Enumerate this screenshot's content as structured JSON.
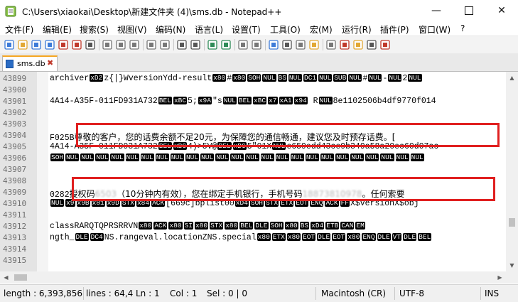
{
  "window": {
    "title": "C:\\Users\\xiaokai\\Desktop\\新建文件夹 (4)\\sms.db - Notepad++",
    "minimize": "—",
    "close": "✕"
  },
  "menu": [
    "文件(F)",
    "编辑(E)",
    "搜索(S)",
    "视图(V)",
    "编码(N)",
    "语言(L)",
    "设置(T)",
    "工具(O)",
    "宏(M)",
    "运行(R)",
    "插件(P)",
    "窗口(W)",
    "?"
  ],
  "toolbar_icons": [
    "new-file-icon",
    "open-file-icon",
    "save-icon",
    "save-all-icon",
    "close-icon",
    "close-all-icon",
    "print-icon",
    "cut-icon",
    "copy-icon",
    "paste-icon",
    "undo-icon",
    "redo-icon",
    "find-icon",
    "replace-icon",
    "zoom-in-icon",
    "zoom-out-icon",
    "sync-v-icon",
    "sync-h-icon",
    "word-wrap-icon",
    "all-chars-icon",
    "indent-guide-icon",
    "udl-icon",
    "doc-map-icon",
    "function-list-icon",
    "folder-workspace-icon",
    "monitor-icon",
    "record-macro-icon"
  ],
  "tab": {
    "label": "sms.db",
    "close": "✖"
  },
  "editor": {
    "lines": [
      {
        "no": "43899",
        "segments": [
          {
            "t": "archiver"
          },
          {
            "c": "xD2"
          },
          {
            "t": "z{|}WversionYdd-result"
          },
          {
            "c": "x80"
          },
          {
            "t": "#"
          },
          {
            "c": "x80"
          },
          {
            "c": "SOH"
          },
          {
            "c": "NUL"
          },
          {
            "c": "BS"
          },
          {
            "c": "NUL"
          },
          {
            "c": "DC1"
          },
          {
            "c": "NUL"
          },
          {
            "c": "SUB"
          },
          {
            "c": "NUL"
          },
          {
            "t": "#"
          },
          {
            "c": "NUL"
          },
          {
            "t": "-"
          },
          {
            "c": "NUL"
          },
          {
            "t": "2"
          },
          {
            "c": "NUL"
          }
        ]
      },
      {
        "no": "43900",
        "segments": []
      },
      {
        "no": "43901",
        "segments": [
          {
            "t": "4A14-A35F-011FD931A732"
          },
          {
            "c": "BEL"
          },
          {
            "c": "xBC"
          },
          {
            "t": "5;"
          },
          {
            "c": "x9A"
          },
          {
            "t": "\"s"
          },
          {
            "c": "NUL"
          },
          {
            "c": "BEL"
          },
          {
            "c": "xBC"
          },
          {
            "c": "x7"
          },
          {
            "c": "xA1"
          },
          {
            "c": "x94"
          },
          {
            "t": " R"
          },
          {
            "c": "NUL"
          },
          {
            "t": "8e1102506b4df9770f014"
          }
        ]
      },
      {
        "no": "43902",
        "segments": []
      },
      {
        "no": "43903",
        "segments": []
      },
      {
        "no": "43904",
        "segments": [
          {
            "t": "F025B"
          },
          {
            "k": "尊敬的客户，您的话费余额不足20元，为保障您的通信畅通，建议您及时预存话费。["
          }
        ]
      },
      {
        "no": "43905",
        "segments": [
          {
            "t": "4A14-A35F-011FD931A732"
          },
          {
            "c": "BEL"
          },
          {
            "c": "xBC"
          },
          {
            "t": "4)>5V@"
          },
          {
            "c": "BEL"
          },
          {
            "c": "xBC"
          },
          {
            "t": "5\"01X"
          },
          {
            "c": "NUL"
          },
          {
            "t": "e659edd43ce9b349a58a20ec60d07ac"
          }
        ]
      },
      {
        "no": "43906",
        "segments": [
          {
            "c": "SOH"
          },
          {
            "c": "NUL"
          },
          {
            "c": "NUL"
          },
          {
            "c": "NUL"
          },
          {
            "c": "NUL"
          },
          {
            "c": "NUL"
          },
          {
            "c": "NUL"
          },
          {
            "c": "NUL"
          },
          {
            "c": "NUL"
          },
          {
            "c": "NUL"
          },
          {
            "c": "NUL"
          },
          {
            "c": "NUL"
          },
          {
            "c": "NUL"
          },
          {
            "c": "NUL"
          },
          {
            "c": "NUL"
          },
          {
            "c": "NUL"
          },
          {
            "c": "NUL"
          },
          {
            "c": "NUL"
          },
          {
            "c": "NUL"
          },
          {
            "c": "NUL"
          },
          {
            "c": "NUL"
          },
          {
            "c": "NUL"
          },
          {
            "c": "NUL"
          },
          {
            "c": "NUL"
          },
          {
            "c": "NUL"
          }
        ]
      },
      {
        "no": "43907",
        "segments": []
      },
      {
        "no": "43908",
        "segments": []
      },
      {
        "no": "43909",
        "segments": [
          {
            "t": "0282"
          },
          {
            "k": "授权码"
          },
          {
            "b": "6503"
          },
          {
            "k": "（10分钟内有效），您在绑定手机银行，手机号码"
          },
          {
            "b": "18873810978"
          },
          {
            "k": "。任何索要"
          }
        ]
      },
      {
        "no": "43910",
        "segments": [
          {
            "c": "NUL"
          },
          {
            "c": "x9"
          },
          {
            "c": "x9B"
          },
          {
            "c": "x81"
          },
          {
            "c": "x9D"
          },
          {
            "c": "STX"
          },
          {
            "c": "x84"
          },
          {
            "c": "ACK"
          },
          {
            "t": "[669c]bplist00"
          },
          {
            "c": "xD4"
          },
          {
            "c": "SOH"
          },
          {
            "c": "STX"
          },
          {
            "c": "ETX"
          },
          {
            "c": "EOT"
          },
          {
            "c": "ENQ"
          },
          {
            "c": "ACK"
          },
          {
            "c": "FF"
          },
          {
            "t": "X$versionX$obj"
          }
        ]
      },
      {
        "no": "43911",
        "segments": []
      },
      {
        "no": "43912",
        "segments": [
          {
            "t": "classRARQTQPRSRRVN"
          },
          {
            "c": "x80"
          },
          {
            "c": "ACK"
          },
          {
            "c": "x80"
          },
          {
            "c": "SI"
          },
          {
            "c": "x80"
          },
          {
            "c": "STX"
          },
          {
            "c": "x80"
          },
          {
            "c": "BEL"
          },
          {
            "c": "DLE"
          },
          {
            "c": "SOH"
          },
          {
            "c": "x80"
          },
          {
            "c": "BS"
          },
          {
            "c": "xD4"
          },
          {
            "c": "ETB"
          },
          {
            "c": "CAN"
          },
          {
            "c": "EM"
          }
        ]
      },
      {
        "no": "43913",
        "segments": [
          {
            "t": "ngth_"
          },
          {
            "c": "DLE"
          },
          {
            "c": "DC4"
          },
          {
            "t": "NS.rangeval.locationZNS.special"
          },
          {
            "c": "x80"
          },
          {
            "c": "ETX"
          },
          {
            "c": "x80"
          },
          {
            "c": "EOT"
          },
          {
            "c": "DLE"
          },
          {
            "c": "EOT"
          },
          {
            "c": "x80"
          },
          {
            "c": "ENQ"
          },
          {
            "c": "DLE"
          },
          {
            "c": "VT"
          },
          {
            "c": "DLE"
          },
          {
            "c": "BEL"
          }
        ]
      },
      {
        "no": "43914",
        "segments": []
      },
      {
        "no": "43915",
        "segments": []
      }
    ]
  },
  "status": {
    "length": "length : 6,393,856",
    "lines": "lines : 64,49",
    "ln": "Ln : 1",
    "col": "Col : 1",
    "sel": "Sel : 0 | 0",
    "eol": "Macintosh (CR)",
    "encoding": "UTF-8",
    "mode": "INS"
  },
  "colors": {
    "highlight_border": "#e02020",
    "tab_accent": "#f5a623",
    "control_char_bg": "#000000",
    "gutter_bg": "#e4e4e4"
  }
}
